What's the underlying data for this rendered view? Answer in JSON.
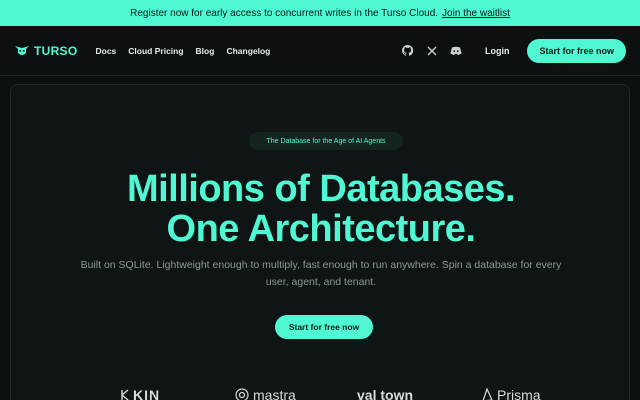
{
  "banner": {
    "text": "Register now for early access to concurrent writes in the Turso Cloud.",
    "link": "Join the waitlist"
  },
  "nav": {
    "logo": "TURSO",
    "links": [
      "Docs",
      "Cloud Pricing",
      "Blog",
      "Changelog"
    ],
    "social": [
      "github-icon",
      "x-icon",
      "discord-icon"
    ],
    "login": "Login",
    "cta": "Start for free now"
  },
  "hero": {
    "pill": "The Database for the Age of AI Agents",
    "headline_1": "Millions of Databases.",
    "headline_2": "One Architecture.",
    "sub_1": "Built on SQLite. Lightweight enough to multiply, fast enough to run anywhere. Spin a database for every",
    "sub_2": "user, agent, and tenant.",
    "cta": "Start for free now"
  },
  "logos": [
    "KIN",
    "mastra",
    "val town",
    "Prisma"
  ],
  "colors": {
    "accent": "#4ff8d2",
    "background": "#0c1011"
  }
}
